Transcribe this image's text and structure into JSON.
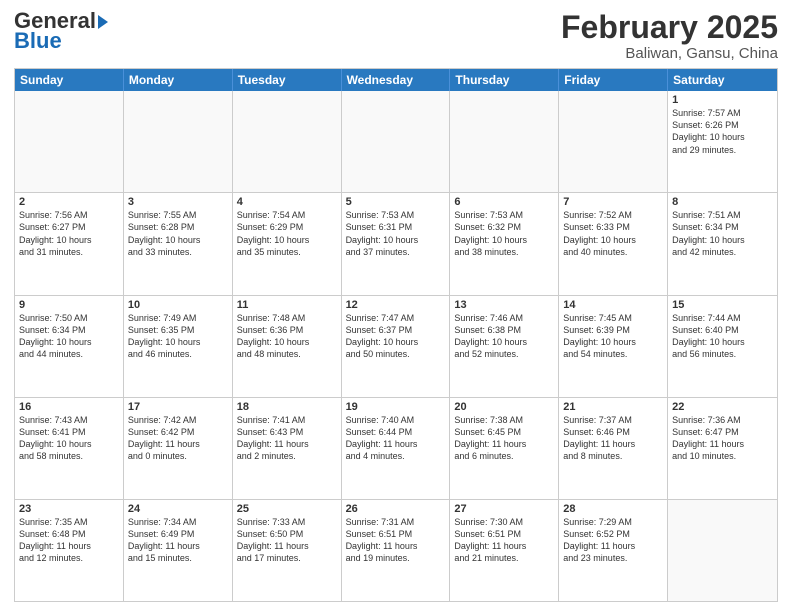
{
  "header": {
    "logo_line1": "General",
    "logo_line2": "Blue",
    "month_title": "February 2025",
    "location": "Baliwan, Gansu, China"
  },
  "days_of_week": [
    "Sunday",
    "Monday",
    "Tuesday",
    "Wednesday",
    "Thursday",
    "Friday",
    "Saturday"
  ],
  "weeks": [
    [
      {
        "day": "",
        "info": "",
        "empty": true
      },
      {
        "day": "",
        "info": "",
        "empty": true
      },
      {
        "day": "",
        "info": "",
        "empty": true
      },
      {
        "day": "",
        "info": "",
        "empty": true
      },
      {
        "day": "",
        "info": "",
        "empty": true
      },
      {
        "day": "",
        "info": "",
        "empty": true
      },
      {
        "day": "1",
        "info": "Sunrise: 7:57 AM\nSunset: 6:26 PM\nDaylight: 10 hours\nand 29 minutes."
      }
    ],
    [
      {
        "day": "2",
        "info": "Sunrise: 7:56 AM\nSunset: 6:27 PM\nDaylight: 10 hours\nand 31 minutes."
      },
      {
        "day": "3",
        "info": "Sunrise: 7:55 AM\nSunset: 6:28 PM\nDaylight: 10 hours\nand 33 minutes."
      },
      {
        "day": "4",
        "info": "Sunrise: 7:54 AM\nSunset: 6:29 PM\nDaylight: 10 hours\nand 35 minutes."
      },
      {
        "day": "5",
        "info": "Sunrise: 7:53 AM\nSunset: 6:31 PM\nDaylight: 10 hours\nand 37 minutes."
      },
      {
        "day": "6",
        "info": "Sunrise: 7:53 AM\nSunset: 6:32 PM\nDaylight: 10 hours\nand 38 minutes."
      },
      {
        "day": "7",
        "info": "Sunrise: 7:52 AM\nSunset: 6:33 PM\nDaylight: 10 hours\nand 40 minutes."
      },
      {
        "day": "8",
        "info": "Sunrise: 7:51 AM\nSunset: 6:34 PM\nDaylight: 10 hours\nand 42 minutes."
      }
    ],
    [
      {
        "day": "9",
        "info": "Sunrise: 7:50 AM\nSunset: 6:34 PM\nDaylight: 10 hours\nand 44 minutes."
      },
      {
        "day": "10",
        "info": "Sunrise: 7:49 AM\nSunset: 6:35 PM\nDaylight: 10 hours\nand 46 minutes."
      },
      {
        "day": "11",
        "info": "Sunrise: 7:48 AM\nSunset: 6:36 PM\nDaylight: 10 hours\nand 48 minutes."
      },
      {
        "day": "12",
        "info": "Sunrise: 7:47 AM\nSunset: 6:37 PM\nDaylight: 10 hours\nand 50 minutes."
      },
      {
        "day": "13",
        "info": "Sunrise: 7:46 AM\nSunset: 6:38 PM\nDaylight: 10 hours\nand 52 minutes."
      },
      {
        "day": "14",
        "info": "Sunrise: 7:45 AM\nSunset: 6:39 PM\nDaylight: 10 hours\nand 54 minutes."
      },
      {
        "day": "15",
        "info": "Sunrise: 7:44 AM\nSunset: 6:40 PM\nDaylight: 10 hours\nand 56 minutes."
      }
    ],
    [
      {
        "day": "16",
        "info": "Sunrise: 7:43 AM\nSunset: 6:41 PM\nDaylight: 10 hours\nand 58 minutes."
      },
      {
        "day": "17",
        "info": "Sunrise: 7:42 AM\nSunset: 6:42 PM\nDaylight: 11 hours\nand 0 minutes."
      },
      {
        "day": "18",
        "info": "Sunrise: 7:41 AM\nSunset: 6:43 PM\nDaylight: 11 hours\nand 2 minutes."
      },
      {
        "day": "19",
        "info": "Sunrise: 7:40 AM\nSunset: 6:44 PM\nDaylight: 11 hours\nand 4 minutes."
      },
      {
        "day": "20",
        "info": "Sunrise: 7:38 AM\nSunset: 6:45 PM\nDaylight: 11 hours\nand 6 minutes."
      },
      {
        "day": "21",
        "info": "Sunrise: 7:37 AM\nSunset: 6:46 PM\nDaylight: 11 hours\nand 8 minutes."
      },
      {
        "day": "22",
        "info": "Sunrise: 7:36 AM\nSunset: 6:47 PM\nDaylight: 11 hours\nand 10 minutes."
      }
    ],
    [
      {
        "day": "23",
        "info": "Sunrise: 7:35 AM\nSunset: 6:48 PM\nDaylight: 11 hours\nand 12 minutes."
      },
      {
        "day": "24",
        "info": "Sunrise: 7:34 AM\nSunset: 6:49 PM\nDaylight: 11 hours\nand 15 minutes."
      },
      {
        "day": "25",
        "info": "Sunrise: 7:33 AM\nSunset: 6:50 PM\nDaylight: 11 hours\nand 17 minutes."
      },
      {
        "day": "26",
        "info": "Sunrise: 7:31 AM\nSunset: 6:51 PM\nDaylight: 11 hours\nand 19 minutes."
      },
      {
        "day": "27",
        "info": "Sunrise: 7:30 AM\nSunset: 6:51 PM\nDaylight: 11 hours\nand 21 minutes."
      },
      {
        "day": "28",
        "info": "Sunrise: 7:29 AM\nSunset: 6:52 PM\nDaylight: 11 hours\nand 23 minutes."
      },
      {
        "day": "",
        "info": "",
        "empty": true
      }
    ]
  ]
}
